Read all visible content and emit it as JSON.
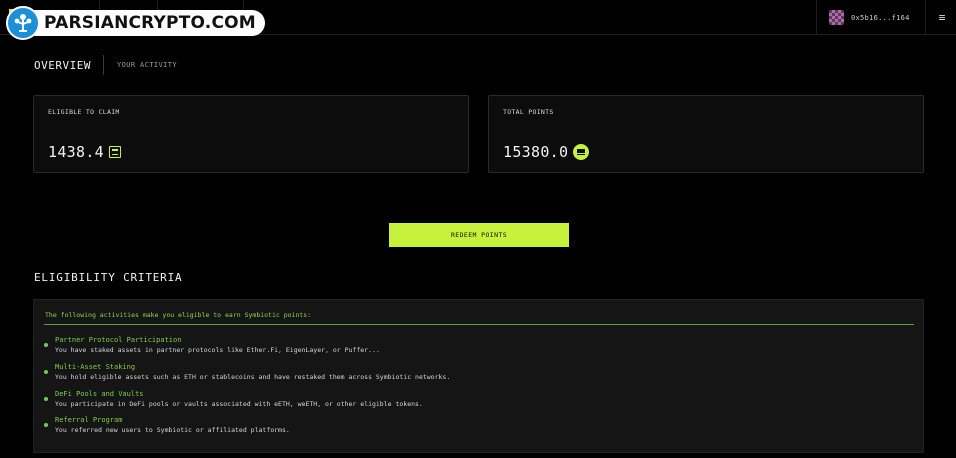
{
  "watermark": {
    "text": "PARSIANCRYPTO.COM"
  },
  "header": {
    "wallet_address": "0x5b16...f164",
    "menu_icon": "≡"
  },
  "tabs": [
    {
      "label": "OVERVIEW",
      "active": true
    },
    {
      "label": "YOUR ACTIVITY",
      "active": false
    }
  ],
  "cards": [
    {
      "label": "ELIGIBLE TO CLAIM",
      "value": "1438.4",
      "icon": "symbiotic-s-outline-icon"
    },
    {
      "label": "TOTAL POINTS",
      "value": "15380.0",
      "icon": "symbiotic-s-filled-icon"
    }
  ],
  "redeem": {
    "label": "REDEEM POINTS"
  },
  "eligibility": {
    "title": "ELIGIBILITY CRITERIA",
    "intro": "The following activities make you eligible to earn Symbiotic points:",
    "items": [
      {
        "title": "Partner Protocol Participation",
        "desc": "You have staked assets in partner protocols like Ether.Fi, EigenLayer, or Puffer..."
      },
      {
        "title": "Multi-Asset Staking",
        "desc": "You hold eligible assets such as ETH or stablecoins and have restaked them across Symbiotic networks."
      },
      {
        "title": "DeFi Pools and Vaults",
        "desc": "You participate in DeFi pools or vaults associated with eETH, weETH, or other eligible tokens."
      },
      {
        "title": "Referral Program",
        "desc": "You referred new users to Symbiotic or affiliated platforms."
      }
    ]
  },
  "colors": {
    "accent": "#c6f23c",
    "criteria_green": "#7fcf4a",
    "background": "#000000"
  }
}
